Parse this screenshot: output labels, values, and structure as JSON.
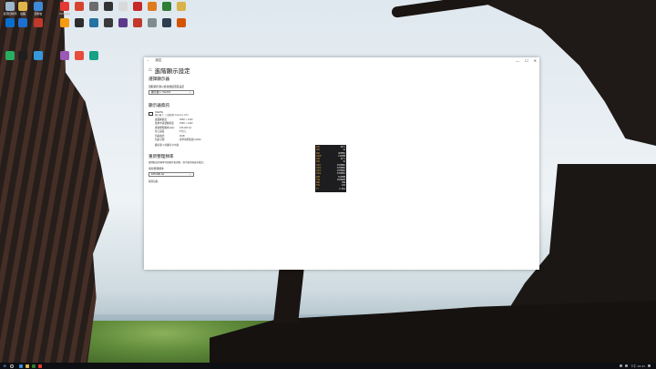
{
  "desktop": {
    "icons": [
      {
        "label": "資源回收筒",
        "color": "#9bb8cf"
      },
      {
        "label": "電腦",
        "color": "#e0b64a"
      },
      {
        "label": "控制台",
        "color": "#3d8bd8"
      },
      {
        "label": "Chrome",
        "color": "#e53935"
      },
      {
        "label": "",
        "color": "#d6442f"
      },
      {
        "label": "",
        "color": "#6c6c6c"
      },
      {
        "label": "",
        "color": "#333"
      },
      {
        "label": "",
        "color": "#d9d9d9"
      },
      {
        "label": "",
        "color": "#c62828"
      },
      {
        "label": "",
        "color": "#e07a1e"
      },
      {
        "label": "",
        "color": "#2f7d36"
      },
      {
        "label": "",
        "color": "#d8b24a"
      },
      {
        "label": "",
        "color": "#0a6ecf"
      },
      {
        "label": "",
        "color": "#1d6fd1"
      },
      {
        "label": "",
        "color": "#c0392b"
      },
      {
        "label": "",
        "color": "#f39c12"
      },
      {
        "label": "",
        "color": "#2d2d2d"
      },
      {
        "label": "",
        "color": "#2471a3"
      },
      {
        "label": "",
        "color": "#3a3a3a"
      },
      {
        "label": "",
        "color": "#5b3a8c"
      },
      {
        "label": "",
        "color": "#c0392b"
      },
      {
        "label": "",
        "color": "#7f8c8d"
      },
      {
        "label": "",
        "color": "#2c3e50"
      },
      {
        "label": "",
        "color": "#d35400"
      },
      {
        "label": "",
        "color": "#27ae60"
      },
      {
        "label": "",
        "color": "#1e1e1e"
      },
      {
        "label": "",
        "color": "#3498db"
      },
      {
        "label": "",
        "color": "#9b59b6"
      },
      {
        "label": "",
        "color": "#e74c3c"
      },
      {
        "label": "",
        "color": "#16a085"
      }
    ]
  },
  "window": {
    "back_label": "設定",
    "controls": {
      "minimize": "—",
      "maximize": "☐",
      "close": "✕"
    },
    "page_title": "進階顯示設定",
    "select_display": {
      "title": "選擇顯示器",
      "label": "選取顯示器以檢視或變更其設定",
      "value": "顯示器 1: VG27A"
    },
    "display_info": {
      "title": "顯示器資訊",
      "monitor_name": "VG27A",
      "monitor_sub": "顯示器 1：已連線到 GeForce GTX",
      "rows": [
        {
          "k": "桌面解析度",
          "v": "2560 × 1440"
        },
        {
          "k": "使用中訊號解析度",
          "v": "2560 × 1440"
        },
        {
          "k": "重新整理頻率 (Hz)",
          "v": "165.000 Hz"
        },
        {
          "k": "位元深度",
          "v": "8 位元"
        },
        {
          "k": "色彩格式",
          "v": "RGB"
        },
        {
          "k": "色彩空間",
          "v": "標準動態範圍 (SDR)"
        }
      ],
      "adapter_link": "顯示器 1 的顯示卡內容"
    },
    "refresh": {
      "title": "重新整理頻率",
      "desc": "選擇較高的頻率可使動作更流暢，但也會消耗更多電力。",
      "label": "重新整理頻率",
      "value": "165.000 Hz"
    },
    "help_link": "取得協助"
  },
  "overlay": {
    "rows": [
      {
        "k": "GPU",
        "v": "38°C"
      },
      {
        "k": "GPU",
        "v": "1%"
      },
      {
        "k": "GPU",
        "v": "405MHz"
      },
      {
        "k": "VRAM",
        "v": "1352MB"
      },
      {
        "k": "CPU",
        "v": "42°C"
      },
      {
        "k": "CPU",
        "v": "3%"
      },
      {
        "k": "CPU1",
        "v": "3700MHz"
      },
      {
        "k": "CPU2",
        "v": "3700MHz"
      },
      {
        "k": "CPU3",
        "v": "3700MHz"
      },
      {
        "k": "CPU4",
        "v": "3700MHz"
      },
      {
        "k": "RAM",
        "v": "6120MB"
      },
      {
        "k": "FAN",
        "v": "1020RPM"
      },
      {
        "k": "PWR",
        "v": "38W"
      },
      {
        "k": "FPS",
        "v": "165"
      },
      {
        "k": "FT",
        "v": "6.0ms"
      }
    ]
  },
  "taskbar": {
    "start_glyph": "⊞",
    "apps": [
      "#3d8bd8",
      "#e0b64a",
      "#2e7d32",
      "#e53935"
    ],
    "clock": "下午 10:41"
  }
}
